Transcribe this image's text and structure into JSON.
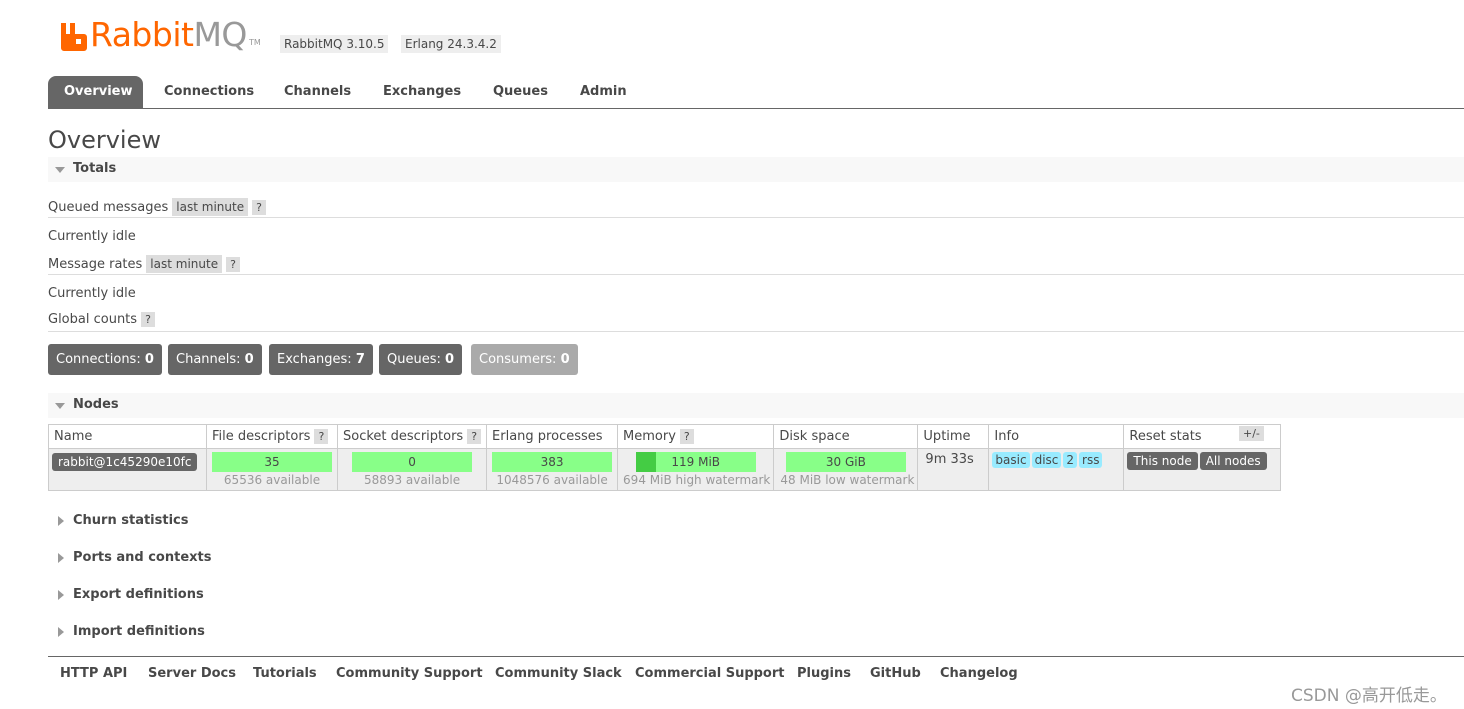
{
  "header": {
    "logo_brand": "Rabbit",
    "logo_suffix": "MQ",
    "logo_tm": "TM",
    "rabbitmq_version": "RabbitMQ 3.10.5",
    "erlang_version": "Erlang 24.3.4.2"
  },
  "nav": {
    "tabs": [
      {
        "label": "Overview",
        "active": true
      },
      {
        "label": "Connections"
      },
      {
        "label": "Channels"
      },
      {
        "label": "Exchanges"
      },
      {
        "label": "Queues"
      },
      {
        "label": "Admin"
      }
    ]
  },
  "page_title": "Overview",
  "totals": {
    "section_label": "Totals",
    "queued_messages_label": "Queued messages",
    "queued_messages_range": "last minute",
    "queued_status": "Currently idle",
    "message_rates_label": "Message rates",
    "message_rates_range": "last minute",
    "rates_status": "Currently idle",
    "global_counts_label": "Global counts",
    "help": "?",
    "counts": [
      {
        "label": "Connections:",
        "value": "0"
      },
      {
        "label": "Channels:",
        "value": "0"
      },
      {
        "label": "Exchanges:",
        "value": "7"
      },
      {
        "label": "Queues:",
        "value": "0"
      },
      {
        "label": "Consumers:",
        "value": "0"
      }
    ]
  },
  "nodes": {
    "section_label": "Nodes",
    "plus_minus": "+/-",
    "columns": {
      "name": "Name",
      "file_descriptors": "File descriptors",
      "socket_descriptors": "Socket descriptors",
      "erlang_processes": "Erlang processes",
      "memory": "Memory",
      "disk_space": "Disk space",
      "uptime": "Uptime",
      "info": "Info",
      "reset_stats": "Reset stats"
    },
    "row": {
      "name": "rabbit@1c45290e10fc",
      "file_descriptors": "35",
      "file_descriptors_available": "65536 available",
      "socket_descriptors": "0",
      "socket_descriptors_available": "58893 available",
      "erlang_processes": "383",
      "erlang_processes_available": "1048576 available",
      "memory": "119 MiB",
      "memory_fraction": 0.17,
      "memory_watermark": "694 MiB high watermark",
      "disk_space": "30 GiB",
      "disk_watermark": "48 MiB low watermark",
      "uptime": "9m 33s",
      "info_tags": [
        "basic",
        "disc",
        "2",
        "rss"
      ],
      "reset_this_node": "This node",
      "reset_all_nodes": "All nodes"
    }
  },
  "collapsed_sections": [
    "Churn statistics",
    "Ports and contexts",
    "Export definitions",
    "Import definitions"
  ],
  "footer": {
    "links": [
      "HTTP API",
      "Server Docs",
      "Tutorials",
      "Community Support",
      "Community Slack",
      "Commercial Support",
      "Plugins",
      "GitHub",
      "Changelog"
    ]
  },
  "watermark": "CSDN @高开低走。",
  "colors": {
    "brand_orange": "#ff6600",
    "tab_active": "#666666",
    "bar_green": "#88ff88",
    "info_blue": "#99ebff"
  }
}
